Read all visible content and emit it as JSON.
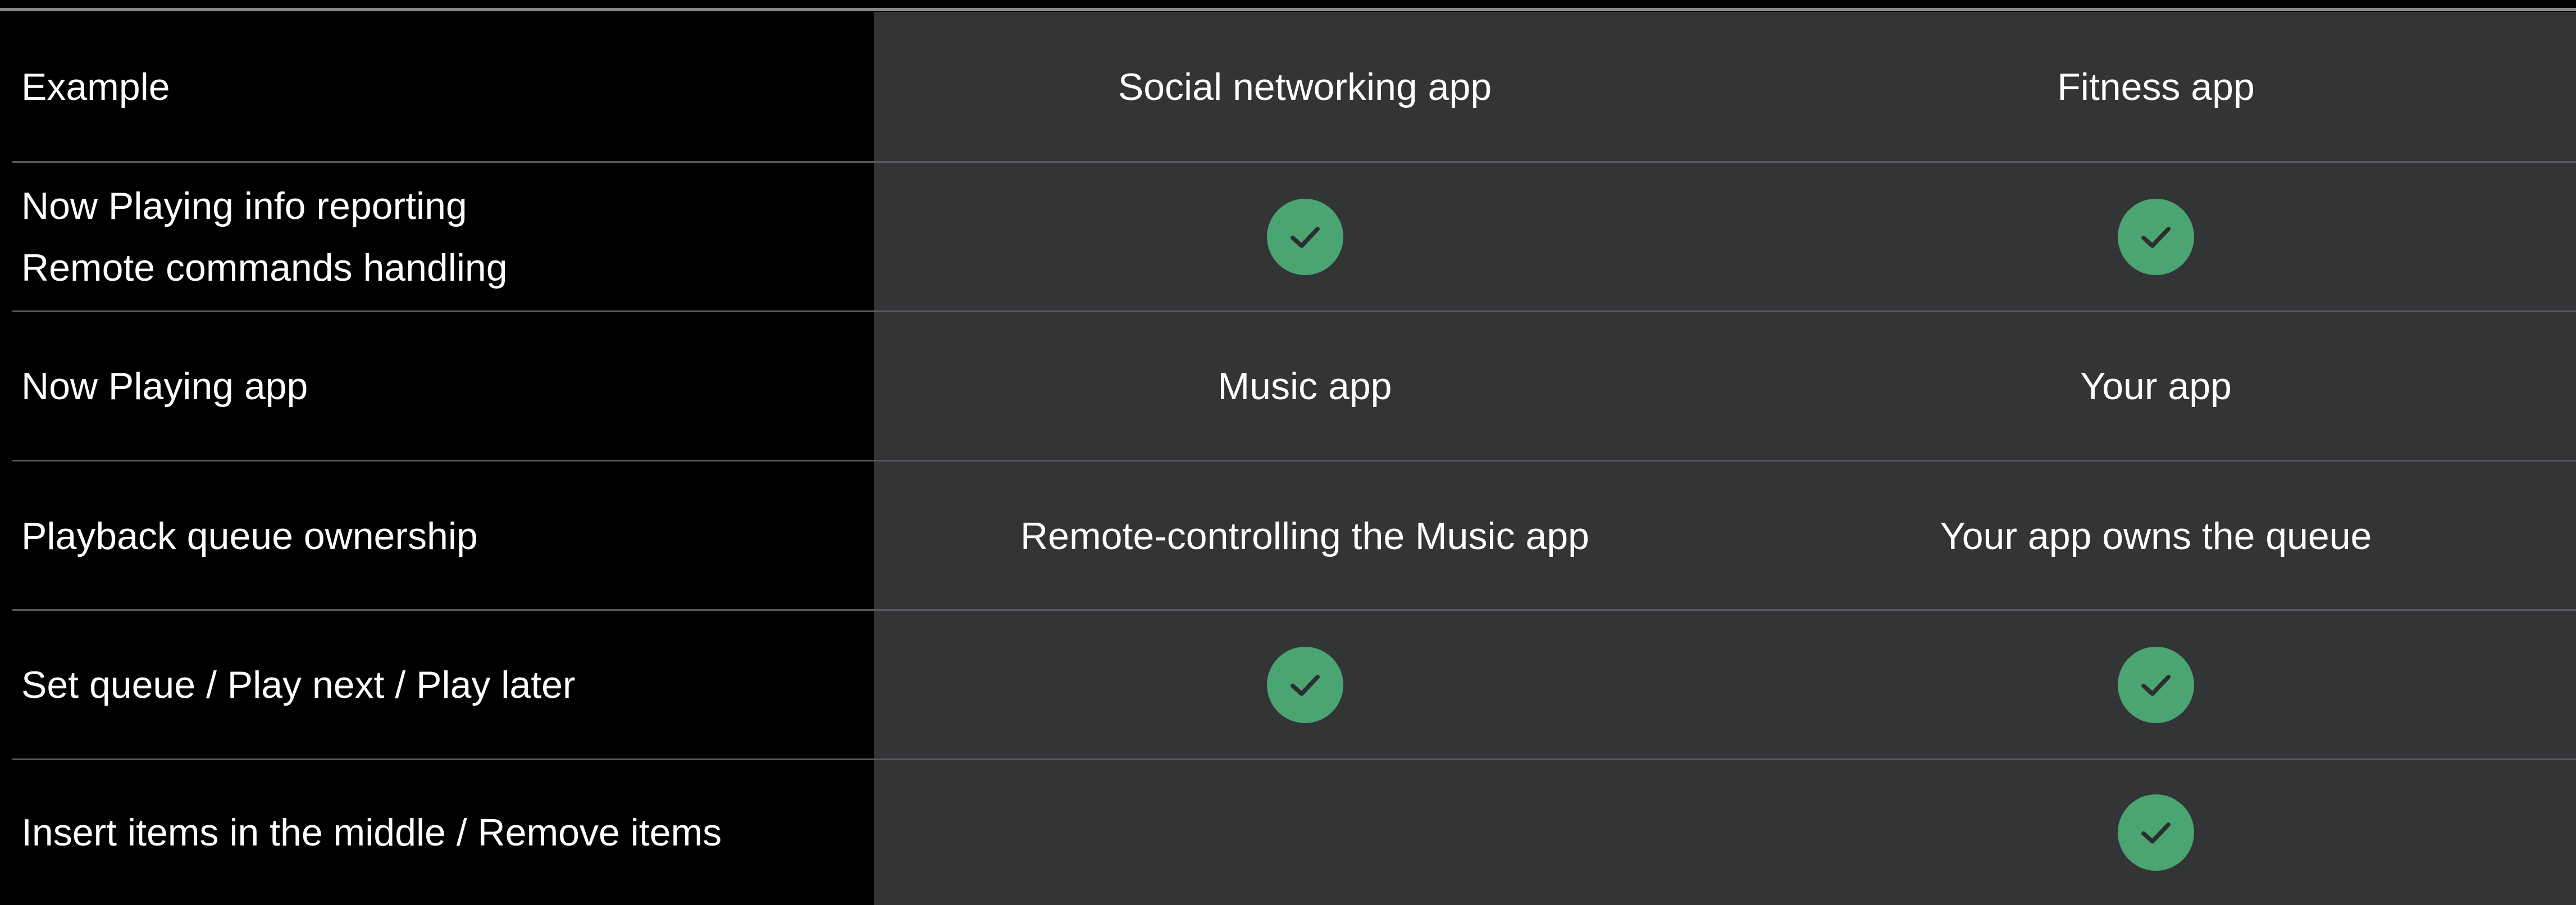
{
  "colors": {
    "background": "#000000",
    "value_columns_background": "#333436",
    "divider": "#58585c",
    "check_fill": "#4aa572",
    "check_mark": "#2b2d2e",
    "text": "#ffffff"
  },
  "header": {
    "label": "Example",
    "col1": "Social networking app",
    "col2": "Fitness app"
  },
  "rows": [
    {
      "label_lines": [
        "Now Playing info reporting",
        "Remote commands handling"
      ],
      "col1_icon": "checkmark-icon",
      "col2_icon": "checkmark-icon"
    },
    {
      "label": "Now Playing app",
      "col1": "Music app",
      "col2": "Your app"
    },
    {
      "label": "Playback queue ownership",
      "col1": "Remote-controlling the Music app",
      "col2": "Your app owns the queue"
    },
    {
      "label": "Set queue / Play next / Play later",
      "col1_icon": "checkmark-icon",
      "col2_icon": "checkmark-icon"
    },
    {
      "label": "Insert items in the middle / Remove items",
      "col1": "",
      "col2_icon": "checkmark-icon"
    }
  ]
}
